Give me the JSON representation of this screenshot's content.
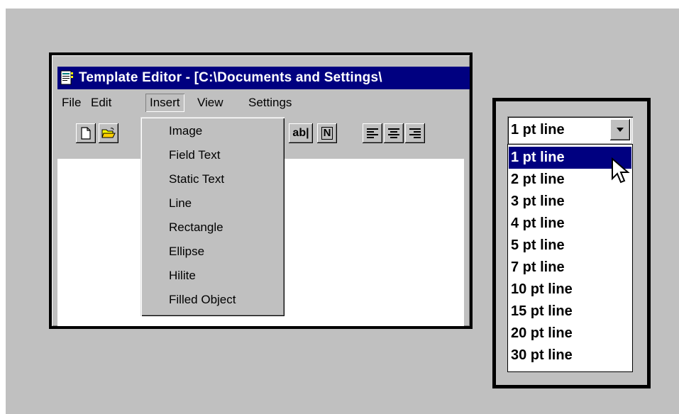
{
  "editor": {
    "title": "Template Editor - [C:\\Documents and Settings\\",
    "menus": [
      "File",
      "Edit",
      "Insert",
      "View",
      "Settings"
    ],
    "active_menu": "Insert",
    "insert_menu_items": [
      "Image",
      "Field Text",
      "Static Text",
      "Line",
      "Rectangle",
      "Ellipse",
      "Hilite",
      "Filled Object"
    ],
    "toolbar": {
      "field_text_label": "ab|",
      "n_label": "N"
    }
  },
  "line_combo": {
    "selected_value": "1 pt line",
    "options": [
      "1 pt line",
      "2 pt line",
      "3 pt line",
      "4 pt line",
      "5 pt line",
      "7 pt line",
      "10 pt line",
      "15 pt line",
      "20 pt line",
      "30 pt line"
    ],
    "highlighted_index": 0
  },
  "colors": {
    "background": "#c0c0c0",
    "title_bar": "#000080",
    "selection": "#000080"
  }
}
